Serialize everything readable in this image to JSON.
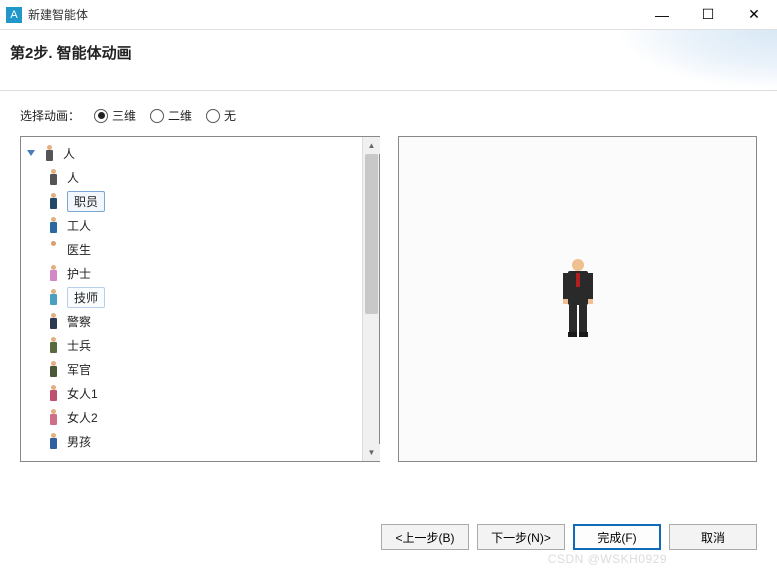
{
  "window": {
    "title": "新建智能体",
    "app_icon_letter": "A"
  },
  "header": {
    "step_title": "第2步. 智能体动画"
  },
  "animation_select": {
    "label": "选择动画：",
    "options": {
      "opt_3d": "三维",
      "opt_2d": "二维",
      "opt_none": "无"
    },
    "selected": "opt_3d"
  },
  "tree": {
    "root_label": "人",
    "items": [
      {
        "label": "人"
      },
      {
        "label": "职员",
        "selected": true,
        "body_color": "#23466b"
      },
      {
        "label": "工人",
        "body_color": "#2b6aa0"
      },
      {
        "label": "医生",
        "body_color": "#ffffff",
        "head_color": "#d8a070"
      },
      {
        "label": "护士",
        "body_color": "#d488c8"
      },
      {
        "label": "技师",
        "hover": true,
        "body_color": "#4aa0c0"
      },
      {
        "label": "警察",
        "body_color": "#2a3850"
      },
      {
        "label": "士兵",
        "body_color": "#5a6a40"
      },
      {
        "label": "军官",
        "body_color": "#4a5838"
      },
      {
        "label": "女人1",
        "body_color": "#c05070"
      },
      {
        "label": "女人2",
        "body_color": "#d07088"
      },
      {
        "label": "男孩",
        "body_color": "#3060a0"
      }
    ]
  },
  "footer": {
    "back": "<上一步(B)",
    "next": "下一步(N)>",
    "finish": "完成(F)",
    "cancel": "取消"
  },
  "watermark": "CSDN @WSKH0929"
}
